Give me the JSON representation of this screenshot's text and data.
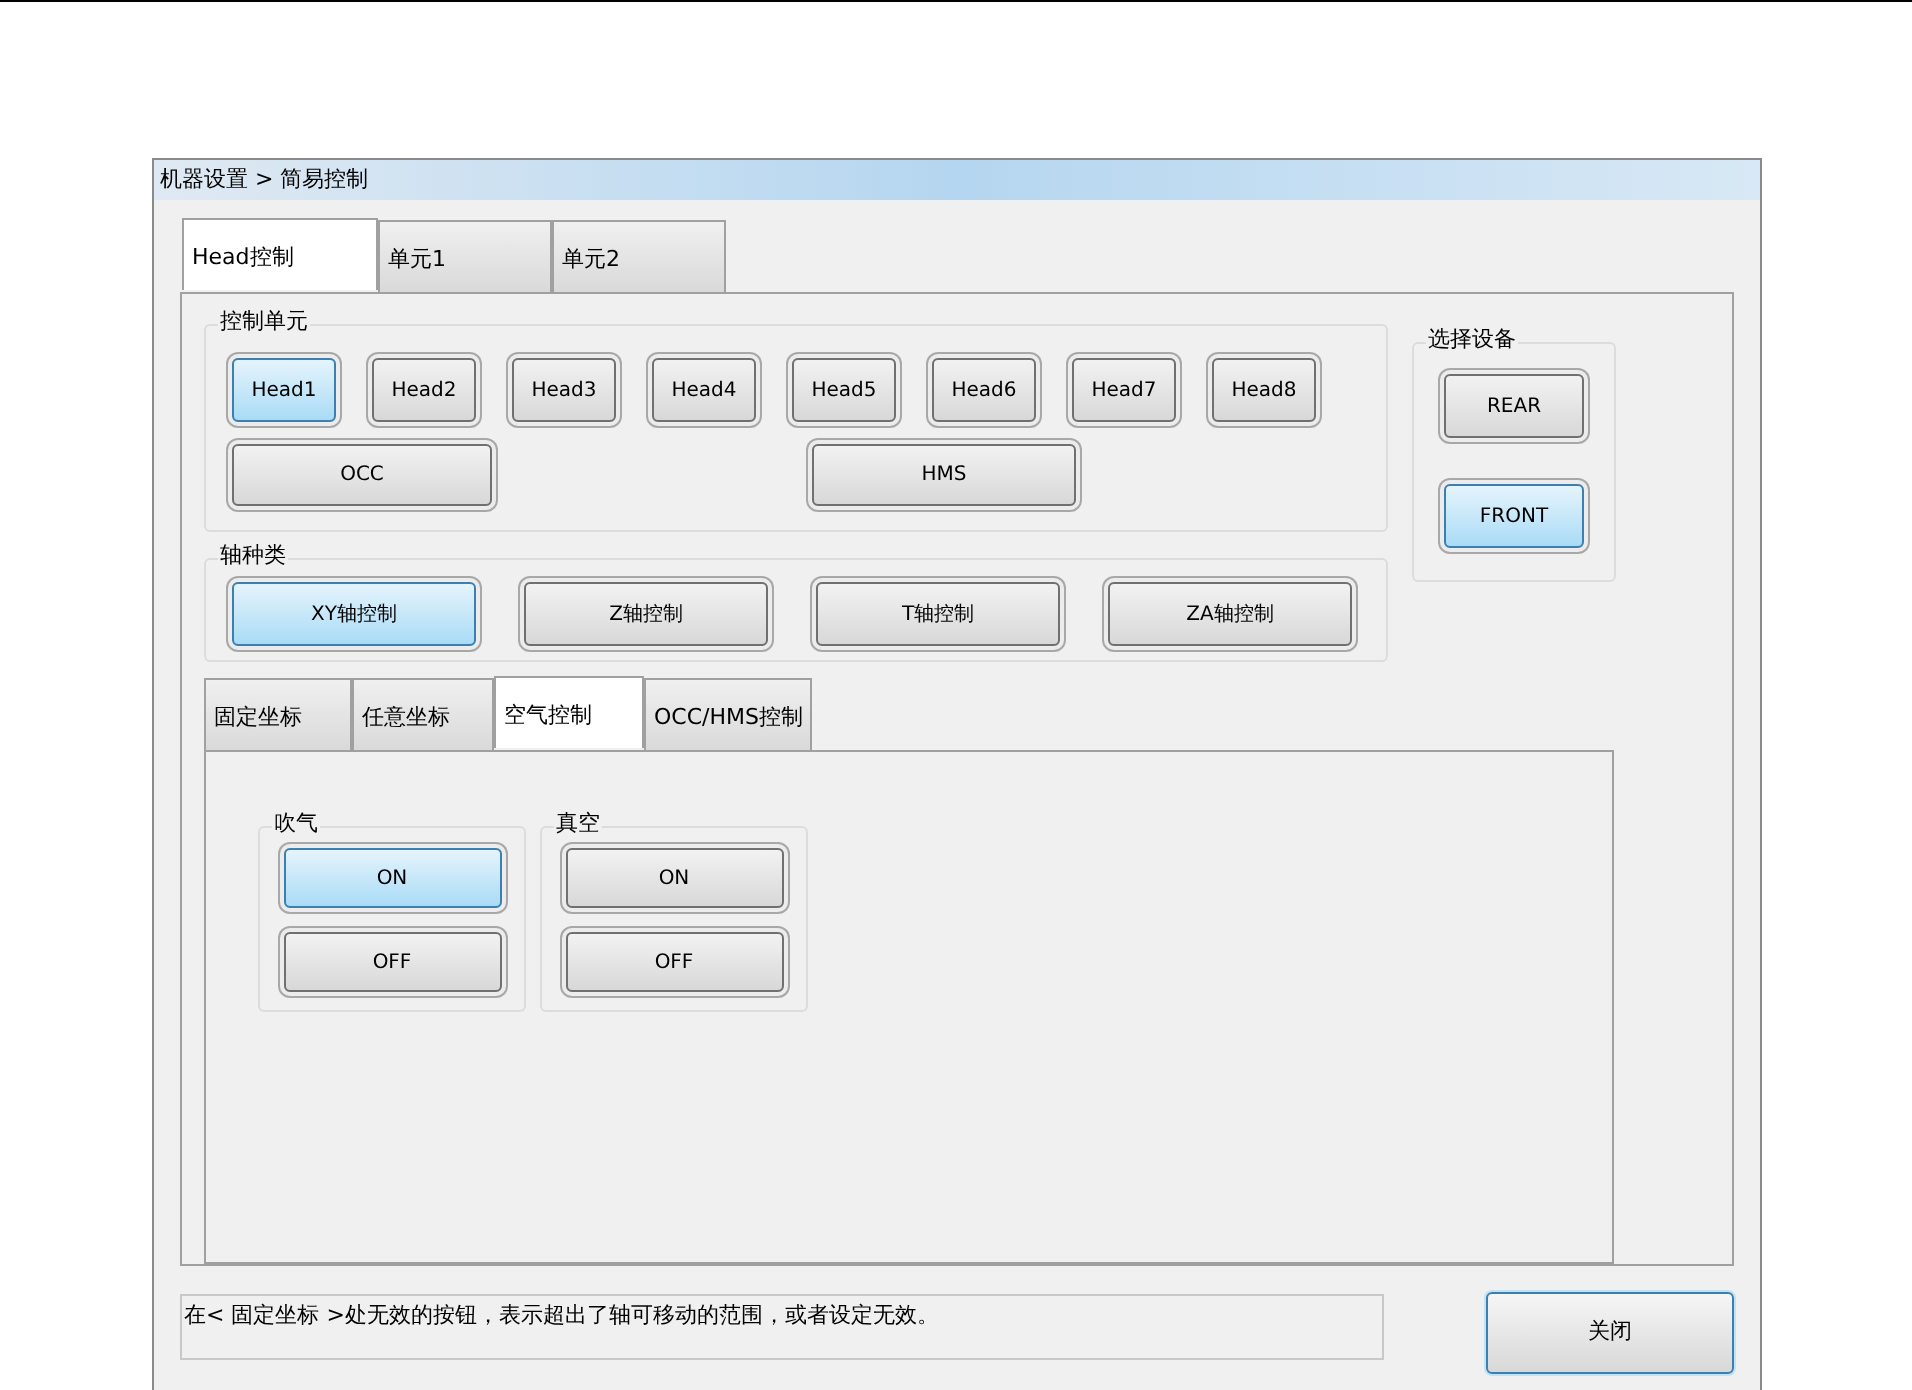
{
  "window": {
    "title": "机器设置 > 简易控制"
  },
  "tabs": [
    {
      "label": "Head控制",
      "selected": true
    },
    {
      "label": "单元1",
      "selected": false
    },
    {
      "label": "单元2",
      "selected": false
    }
  ],
  "control_unit": {
    "title": "控制单元",
    "heads": [
      {
        "label": "Head1",
        "selected": true
      },
      {
        "label": "Head2",
        "selected": false
      },
      {
        "label": "Head3",
        "selected": false
      },
      {
        "label": "Head4",
        "selected": false
      },
      {
        "label": "Head5",
        "selected": false
      },
      {
        "label": "Head6",
        "selected": false
      },
      {
        "label": "Head7",
        "selected": false
      },
      {
        "label": "Head8",
        "selected": false
      }
    ],
    "extra": [
      {
        "label": "OCC",
        "selected": false
      },
      {
        "label": "HMS",
        "selected": false
      }
    ]
  },
  "axis_type": {
    "title": "轴种类",
    "buttons": [
      {
        "label": "XY轴控制",
        "selected": true
      },
      {
        "label": "Z轴控制",
        "selected": false
      },
      {
        "label": "T轴控制",
        "selected": false
      },
      {
        "label": "ZA轴控制",
        "selected": false
      }
    ]
  },
  "device": {
    "title": "选择设备",
    "buttons": [
      {
        "label": "REAR",
        "selected": false
      },
      {
        "label": "FRONT",
        "selected": true
      }
    ]
  },
  "sub_tabs": [
    {
      "label": "固定坐标",
      "selected": false
    },
    {
      "label": "任意坐标",
      "selected": false
    },
    {
      "label": "空气控制",
      "selected": true
    },
    {
      "label": "OCC/HMS控制",
      "selected": false
    }
  ],
  "air_groups": [
    {
      "title": "吹气",
      "buttons": [
        {
          "label": "ON",
          "selected": true
        },
        {
          "label": "OFF",
          "selected": false
        }
      ]
    },
    {
      "title": "真空",
      "buttons": [
        {
          "label": "ON",
          "selected": false
        },
        {
          "label": "OFF",
          "selected": false
        }
      ]
    }
  ],
  "status_message": "在< 固定坐标 >处无效的按钮，表示超出了轴可移动的范围，或者设定无效。",
  "close_button": "关闭"
}
